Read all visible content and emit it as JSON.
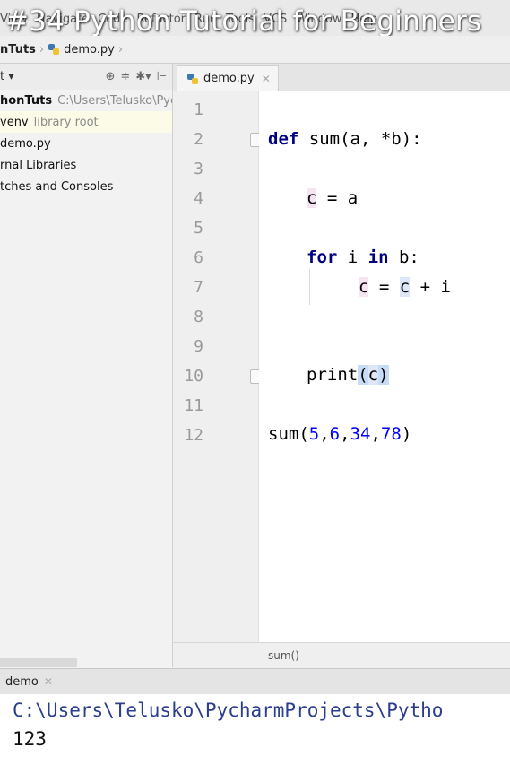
{
  "video_title": "#34 Python Tutorial for Beginners",
  "menu": [
    "View",
    "Navigate",
    "Code",
    "Refactor",
    "Run",
    "Tools",
    "VCS",
    "Window",
    "Help"
  ],
  "breadcrumb": {
    "project": "nTuts",
    "file": "demo.py"
  },
  "project_panel": {
    "header": "t",
    "tree": [
      {
        "name": "honTuts",
        "detail": "C:\\Users\\Telusko\\Pyc"
      },
      {
        "name": "venv",
        "detail": "library root"
      },
      {
        "name": "demo.py",
        "detail": ""
      },
      {
        "name": "rnal Libraries",
        "detail": ""
      },
      {
        "name": "tches and Consoles",
        "detail": ""
      }
    ]
  },
  "editor": {
    "tab_label": "demo.py",
    "line_numbers": [
      "1",
      "2",
      "3",
      "4",
      "5",
      "6",
      "7",
      "8",
      "9",
      "10",
      "11",
      "12"
    ],
    "breadcrumb_footer": "sum()"
  },
  "code": {
    "l2": {
      "kw": "def",
      "rest": " sum(a, *b):"
    },
    "l4": {
      "var": "c",
      "rest": " = a"
    },
    "l6": {
      "kw1": "for",
      "mid": " i ",
      "kw2": "in",
      "rest": " b:"
    },
    "l7": {
      "var1": "c",
      "eq": " = ",
      "var2": "c",
      "rest": " + i"
    },
    "l10": {
      "fn": "print",
      "open": "(",
      "var": "c",
      "close": ")"
    },
    "l12": {
      "fn": "sum(",
      "n1": "5",
      "c1": ",",
      "n2": "6",
      "c2": ",",
      "n3": "34",
      "c3": ",",
      "n4": "78",
      "close": ")"
    }
  },
  "run": {
    "tab_label": "demo",
    "output_path": "C:\\Users\\Telusko\\PycharmProjects\\Pytho",
    "output_value": "123"
  }
}
